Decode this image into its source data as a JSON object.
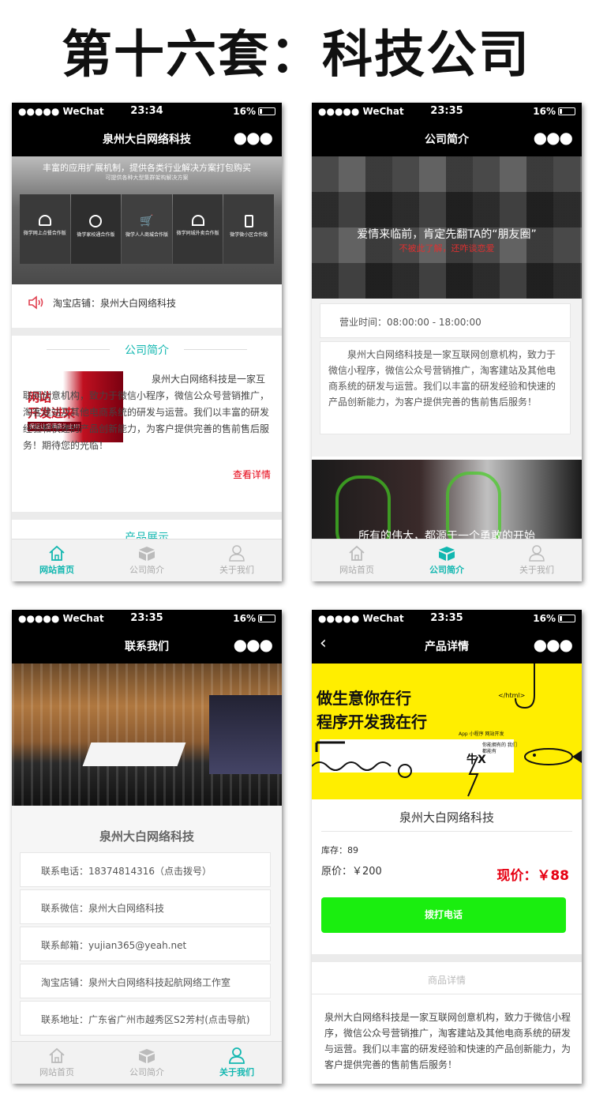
{
  "header": {
    "title": "第十六套：科技公司"
  },
  "status": {
    "carrier": "●●●●● WeChat",
    "battery": "16%",
    "time1": "23:34",
    "time2": "23:35",
    "time3": "23:35",
    "time4": "23:35"
  },
  "tabs": {
    "home": "网站首页",
    "intro": "公司简介",
    "about": "关于我们"
  },
  "screen1": {
    "nav_title": "泉州大白网络科技",
    "banner_title": "丰富的应用扩展机制，提供各类行业解决方案打包购买",
    "banner_sub": "可提供各种大型集群架构解决方案",
    "banner_items": [
      "微学网上点餐合作版",
      "微学家校通合作版",
      "微学人人商城合作版",
      "微学同城外卖合作版",
      "微学微小区合作版"
    ],
    "shop_label": "淘宝店铺：泉州大白网络科技",
    "section_title": "公司简介",
    "intro_img_line1": "网站",
    "intro_img_line2": "开发进来",
    "intro_img_line3": "保证让您满意为止!!!",
    "intro_text": "泉州大白网络科技是一家互联网创意机构，致力于微信小程序，微信公众号营销推广，淘客建站及其他电商系统的研发与运营。我们以丰富的研发经验和快速的产品创新能力，为客户提供完善的售前售后服务！期待您的光临！",
    "more_link": "查看详情",
    "product_title": "产品展示"
  },
  "screen2": {
    "nav_title": "公司简介",
    "banner_main": "爱情来临前，肯定先翻TA的“朋友圈”",
    "banner_sub": "不被此了解，还咋谈恋爱",
    "hours": "营业时间：08:00:00 - 18:00:00",
    "intro_text": "泉州大白网络科技是一家互联网创意机构，致力于微信小程序，微信公众号营销推广，淘客建站及其他电商系统的研发与运营。我们以丰富的研发经验和快速的产品创新能力，为客户提供完善的售前售后服务！",
    "banner2_text": "所有的伟大，都源于一个勇敢的开始"
  },
  "screen3": {
    "nav_title": "联系我们",
    "company": "泉州大白网络科技",
    "rows": [
      "联系电话：18374814316（点击拨号）",
      "联系微信：泉州大白网络科技",
      "联系邮箱：yujian365@yeah.net",
      "淘宝店铺：泉州大白网络科技起航网络工作室",
      "联系地址：广东省广州市越秀区S2芳村(点击导航)"
    ]
  },
  "screen4": {
    "nav_title": "产品详情",
    "banner_line1": "做生意你在行",
    "banner_line2": "程序开发我在行",
    "banner_tag": "</html>",
    "banner_small": "App 小程序 网站开发",
    "banner_badge": "你能拥有的 我们都能有",
    "product_name": "泉州大白网络科技",
    "stock": "库存：89",
    "orig_price": "原价：￥200",
    "now_price": "现价：￥88",
    "call_btn": "拨打电话",
    "detail_title": "商品详情",
    "detail_text": "泉州大白网络科技是一家互联网创意机构，致力于微信小程序，微信公众号营销推广，淘客建站及其他电商系统的研发与运营。我们以丰富的研发经验和快速的产品创新能力，为客户提供完善的售前售后服务！"
  },
  "colors": {
    "accent": "#12b7b0",
    "price_red": "#e60012",
    "call_green": "#1aee0f",
    "banner_yellow": "#ffee00"
  }
}
